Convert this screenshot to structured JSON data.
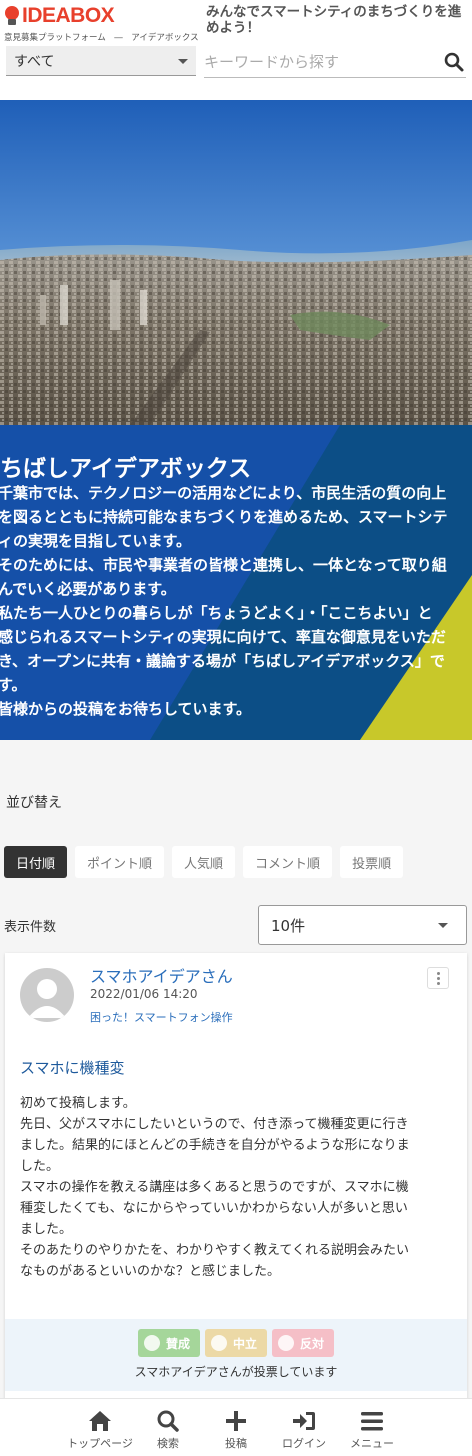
{
  "header": {
    "logo_text": "IDEABOX",
    "logo_sub": "意見募集プラットフォーム　―　アイデアボックス",
    "tagline": "みんなでスマートシティのまちづくりを進めよう！",
    "category_select": "すべて",
    "search_placeholder": "キーワードから探す"
  },
  "intro": {
    "title": "ちばしアイデアボックス",
    "lines": [
      "千葉市では、テクノロジーの活用などにより、市民生活の質の向上",
      "を図るとともに持続可能なまちづくりを進めるため、スマートシテ",
      "ィの実現を目指しています。",
      "そのためには、市民や事業者の皆様と連携し、一体となって取り組",
      "んでいく必要があります。",
      "私たち一人ひとりの暮らしが「ちょうどよく」・「ここちよい」と",
      "感じられるスマートシティの実現に向けて、率直な御意見をいただ",
      "き、オープンに共有・議論する場が「ちばしアイデアボックス」で",
      "す。",
      "皆様からの投稿をお待ちしています。"
    ]
  },
  "sort": {
    "label": "並び替え",
    "tabs": [
      "日付順",
      "ポイント順",
      "人気順",
      "コメント順",
      "投票順"
    ],
    "active": "日付順"
  },
  "display_count": {
    "label": "表示件数",
    "value": "10件"
  },
  "post": {
    "author": "スマホアイデアさん",
    "date": "2022/01/06 14:20",
    "tag": "困った！スマートフォン操作",
    "title": "スマホに機種変",
    "body_lines": [
      "初めて投稿します。",
      "先日、父がスマホにしたいというので、付き添って機種変更に行き",
      "ました。結果的にほとんどの手続きを自分がやるような形になりま",
      "した。",
      "スマホの操作を教える講座は多くあると思うのですが、スマホに機",
      "種変したくても、なにからやっていいかわからない人が多いと思い",
      "ました。",
      "そのあたりのやりかたを、わかりやすく教えてくれる説明会みたい",
      "なものがあるといいのかな？と感じました。"
    ],
    "votes": {
      "agree": "賛成",
      "neutral": "中立",
      "oppose": "反対"
    },
    "vote_status": "スマホアイデアさんが投票しています"
  },
  "bottom_nav": [
    {
      "label": "トップページ",
      "icon": "home-icon"
    },
    {
      "label": "検索",
      "icon": "search-icon"
    },
    {
      "label": "投稿",
      "icon": "plus-icon"
    },
    {
      "label": "ログイン",
      "icon": "login-icon"
    },
    {
      "label": "メニュー",
      "icon": "menu-icon"
    }
  ],
  "colors": {
    "brand": "#e8402c",
    "intro_blue": "#0c4e86",
    "intro_accent": "#c8c82a",
    "link": "#2a6ebb"
  }
}
